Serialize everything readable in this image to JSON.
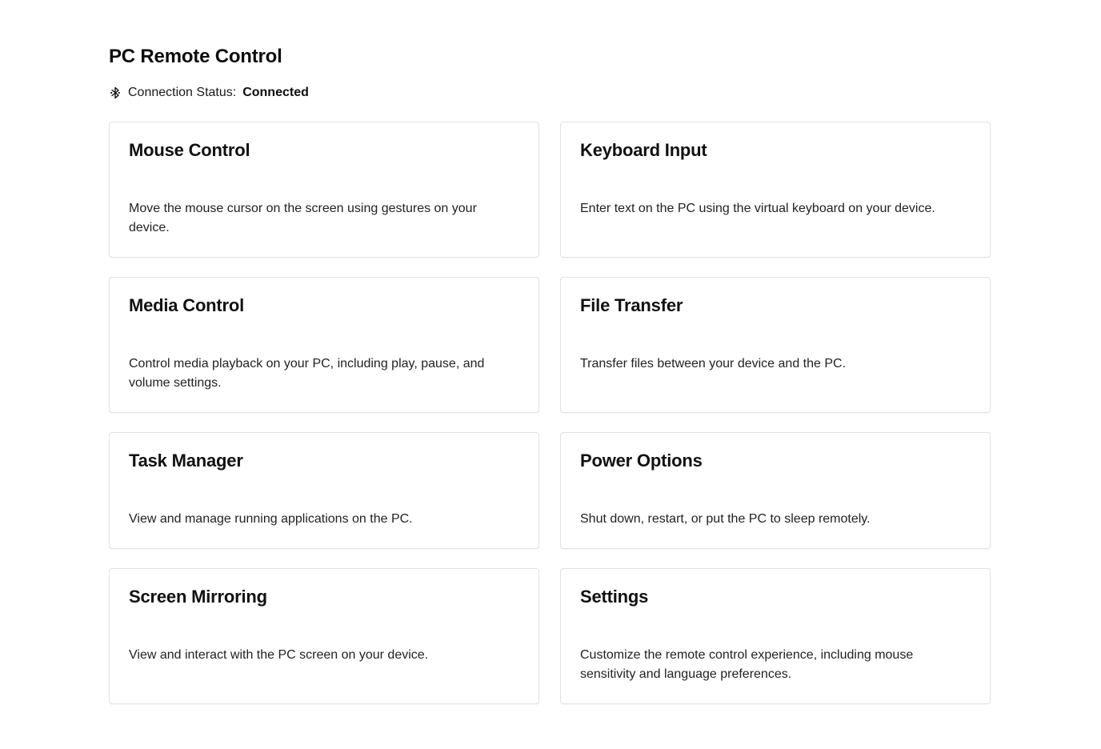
{
  "header": {
    "title": "PC Remote Control",
    "status_label": "Connection Status:",
    "status_value": "Connected",
    "status_icon": "bluetooth-icon"
  },
  "cards": [
    {
      "title": "Mouse Control",
      "description": "Move the mouse cursor on the screen using gestures on your device."
    },
    {
      "title": "Keyboard Input",
      "description": "Enter text on the PC using the virtual keyboard on your device."
    },
    {
      "title": "Media Control",
      "description": "Control media playback on your PC, including play, pause, and volume settings."
    },
    {
      "title": "File Transfer",
      "description": "Transfer files between your device and the PC."
    },
    {
      "title": "Task Manager",
      "description": "View and manage running applications on the PC."
    },
    {
      "title": "Power Options",
      "description": "Shut down, restart, or put the PC to sleep remotely."
    },
    {
      "title": "Screen Mirroring",
      "description": "View and interact with the PC screen on your device."
    },
    {
      "title": "Settings",
      "description": "Customize the remote control experience, including mouse sensitivity and language preferences."
    }
  ]
}
